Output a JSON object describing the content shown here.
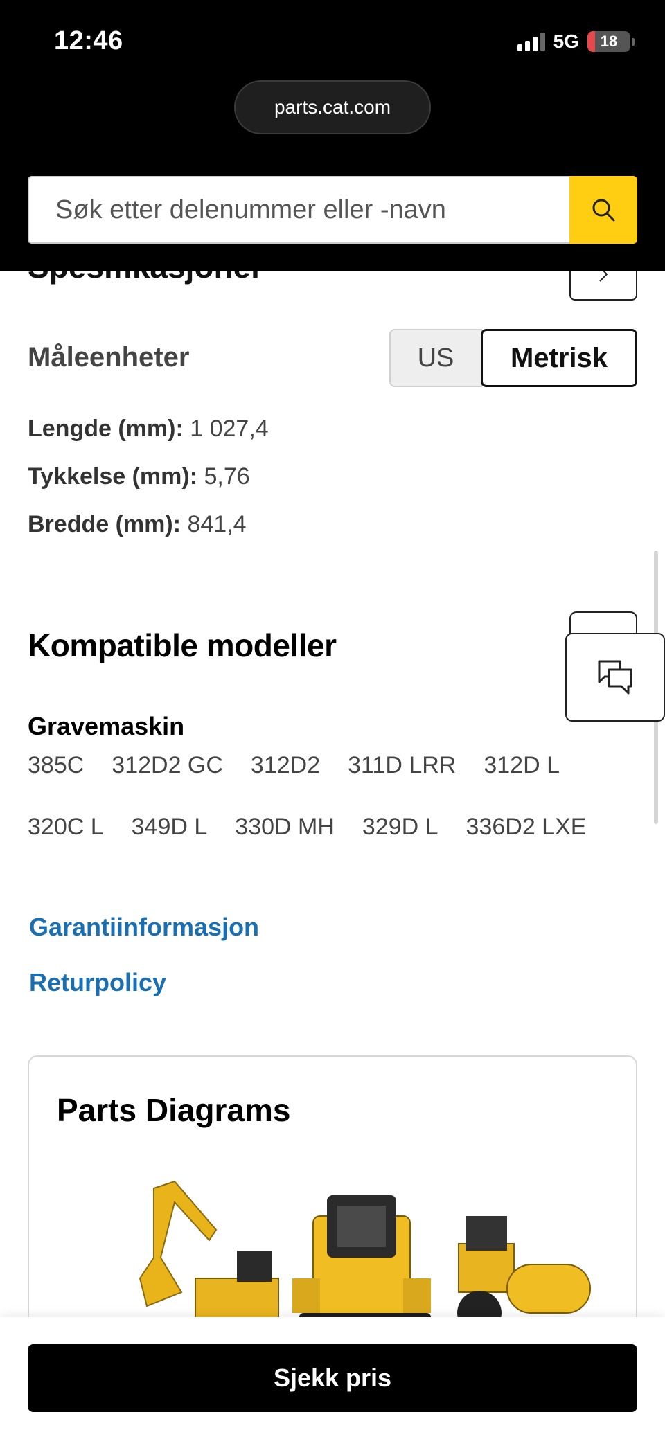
{
  "status_bar": {
    "time": "12:46",
    "network": "5G",
    "battery_level": "18",
    "battery_fraction": 0.18
  },
  "browser": {
    "url": "parts.cat.com"
  },
  "search": {
    "placeholder": "Søk etter delenummer eller -navn",
    "icon": "search-icon"
  },
  "specs": {
    "heading_cut": "Spesifikasjoner",
    "units_label": "Måleenheter",
    "unit_us": "US",
    "unit_metric": "Metrisk",
    "selected_unit": "Metrisk",
    "rows": [
      {
        "label": "Lengde (mm):",
        "value": "1 027,4"
      },
      {
        "label": "Tykkelse (mm):",
        "value": "5,76"
      },
      {
        "label": "Bredde (mm):",
        "value": "841,4"
      }
    ]
  },
  "compatible": {
    "title": "Kompatible modeller",
    "category": "Gravemaskin",
    "models_row1": [
      "385C",
      "312D2 GC",
      "312D2",
      "311D LRR",
      "312D L"
    ],
    "models_row2": [
      "320C L",
      "349D L",
      "330D MH",
      "329D L",
      "336D2 LXE"
    ]
  },
  "links": {
    "warranty": "Garantiinformasjon",
    "returns": "Returpolicy"
  },
  "diagrams": {
    "title": "Parts Diagrams"
  },
  "cta": {
    "check_price": "Sjekk pris"
  },
  "colors": {
    "accent": "#ffcd11",
    "link": "#1a6fb3",
    "chrome": "#000000"
  }
}
